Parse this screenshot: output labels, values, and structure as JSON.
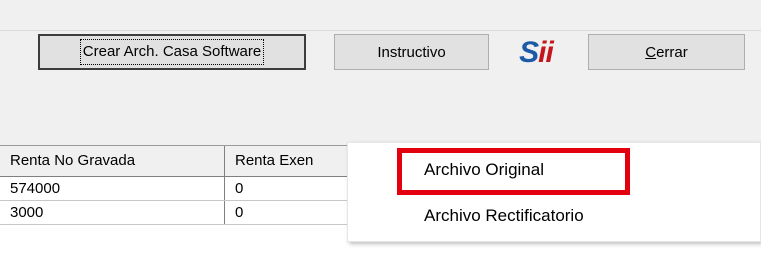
{
  "toolbar": {
    "create_button_label": "Crear Arch. Casa Software",
    "instructivo_button_label": "Instructivo",
    "close_button_prefix": "",
    "close_button_mnemonic": "C",
    "close_button_rest": "errar",
    "logo": {
      "s": "S",
      "ii": "ii"
    }
  },
  "grid": {
    "headers": [
      "Renta No Gravada",
      "Renta Exen"
    ],
    "rows": [
      [
        "574000",
        "0"
      ],
      [
        "3000",
        "0"
      ]
    ]
  },
  "context_menu": {
    "items": [
      "Archivo Original",
      "Archivo Rectificatorio"
    ],
    "highlighted_index": 0,
    "highlight_color": "#e3000f"
  },
  "colors": {
    "background": "#f0f0f0",
    "button_face": "#e1e1e1",
    "logo_blue": "#1c5aa8",
    "logo_red": "#c4161c"
  }
}
